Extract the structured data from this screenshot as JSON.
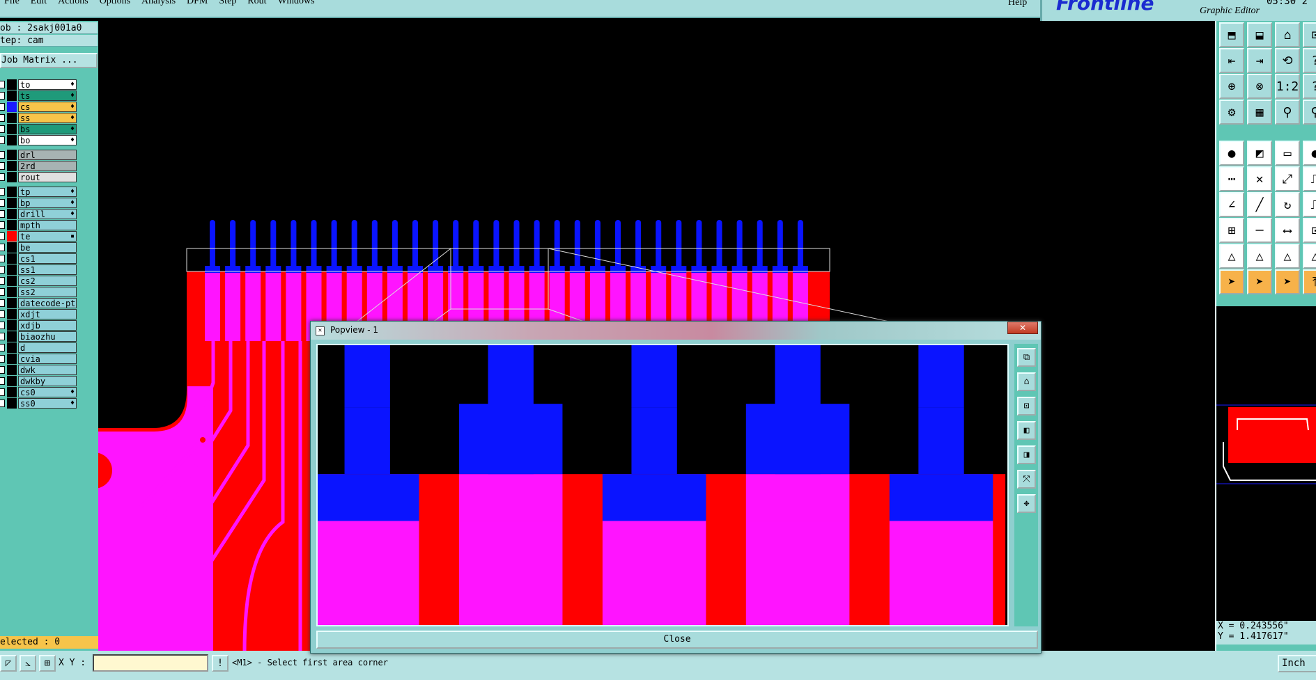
{
  "menu": {
    "items": [
      "File",
      "Edit",
      "Actions",
      "Options",
      "Analysis",
      "DFM",
      "Step",
      "Rout",
      "Windows"
    ],
    "help": "Help"
  },
  "brand": {
    "logo": "Frontline",
    "subtitle": "Graphic Editor",
    "clock": "05:30 2"
  },
  "job": {
    "job_line": "ob : 2sakj001a0",
    "step_line": "tep: cam",
    "matrix_button": "Job Matrix ..."
  },
  "layers": [
    {
      "name": "to",
      "bg": "#ffffff",
      "mark": "♦",
      "swatch": "#000000"
    },
    {
      "name": "ts",
      "bg": "#1f9a7a",
      "mark": "♦",
      "swatch": "#000000"
    },
    {
      "name": "cs",
      "bg": "#f7c44a",
      "mark": "♦",
      "swatch": "#1a1aff"
    },
    {
      "name": "ss",
      "bg": "#f7c44a",
      "mark": "♦",
      "swatch": "#000000"
    },
    {
      "name": "bs",
      "bg": "#1f9a7a",
      "mark": "♦",
      "swatch": "#000000"
    },
    {
      "name": "bo",
      "bg": "#ffffff",
      "mark": "♦",
      "swatch": "#000000"
    },
    {
      "name": "drl",
      "bg": "#a7b3b3",
      "mark": "",
      "swatch": "#000000"
    },
    {
      "name": "2rd",
      "bg": "#a7b3b3",
      "mark": "",
      "swatch": "#000000"
    },
    {
      "name": "rout",
      "bg": "#e0e0e0",
      "mark": "",
      "swatch": "#000000"
    },
    {
      "name": "tp",
      "bg": "#8fd0d8",
      "mark": "♦",
      "swatch": "#000000"
    },
    {
      "name": "bp",
      "bg": "#8fd0d8",
      "mark": "♦",
      "swatch": "#000000"
    },
    {
      "name": "drill",
      "bg": "#8fd0d8",
      "mark": "♦",
      "swatch": "#000000"
    },
    {
      "name": "mpth",
      "bg": "#8fd0d8",
      "mark": "",
      "swatch": "#000000"
    },
    {
      "name": "te",
      "bg": "#8fd0d8",
      "mark": "▪",
      "swatch": "#ff0000"
    },
    {
      "name": "be",
      "bg": "#8fd0d8",
      "mark": "",
      "swatch": "#000000"
    },
    {
      "name": "cs1",
      "bg": "#8fd0d8",
      "mark": "",
      "swatch": "#000000"
    },
    {
      "name": "ss1",
      "bg": "#8fd0d8",
      "mark": "",
      "swatch": "#000000"
    },
    {
      "name": "cs2",
      "bg": "#8fd0d8",
      "mark": "",
      "swatch": "#000000"
    },
    {
      "name": "ss2",
      "bg": "#8fd0d8",
      "mark": "",
      "swatch": "#000000"
    },
    {
      "name": "datecode-pt",
      "bg": "#8fd0d8",
      "mark": "",
      "swatch": "#000000"
    },
    {
      "name": "xdjt",
      "bg": "#8fd0d8",
      "mark": "",
      "swatch": "#000000"
    },
    {
      "name": "xdjb",
      "bg": "#8fd0d8",
      "mark": "",
      "swatch": "#000000"
    },
    {
      "name": "biaozhu",
      "bg": "#8fd0d8",
      "mark": "",
      "swatch": "#000000"
    },
    {
      "name": "d",
      "bg": "#8fd0d8",
      "mark": "",
      "swatch": "#000000"
    },
    {
      "name": "cvia",
      "bg": "#8fd0d8",
      "mark": "",
      "swatch": "#000000"
    },
    {
      "name": "dwk",
      "bg": "#8fd0d8",
      "mark": "",
      "swatch": "#000000"
    },
    {
      "name": "dwkby",
      "bg": "#8fd0d8",
      "mark": "",
      "swatch": "#000000"
    },
    {
      "name": "cs0",
      "bg": "#8fd0d8",
      "mark": "♦",
      "swatch": "#000000"
    },
    {
      "name": "ss0",
      "bg": "#8fd0d8",
      "mark": "♦",
      "swatch": "#000000"
    }
  ],
  "selected_label": "elected : 0",
  "popview": {
    "title": "Popview - 1",
    "close_label": "Close",
    "close_x": "✕"
  },
  "coords": {
    "x": "X = 0.243556\"",
    "y": "Y = 1.417617\""
  },
  "status": {
    "xy_label": "X Y :",
    "message": "<M1> - Select first area corner",
    "units": "Inch"
  },
  "colors": {
    "copper": "#ff0000",
    "mask": "#ff14ff",
    "pad": "#0a14ff",
    "panel": "#5fc6b4"
  }
}
